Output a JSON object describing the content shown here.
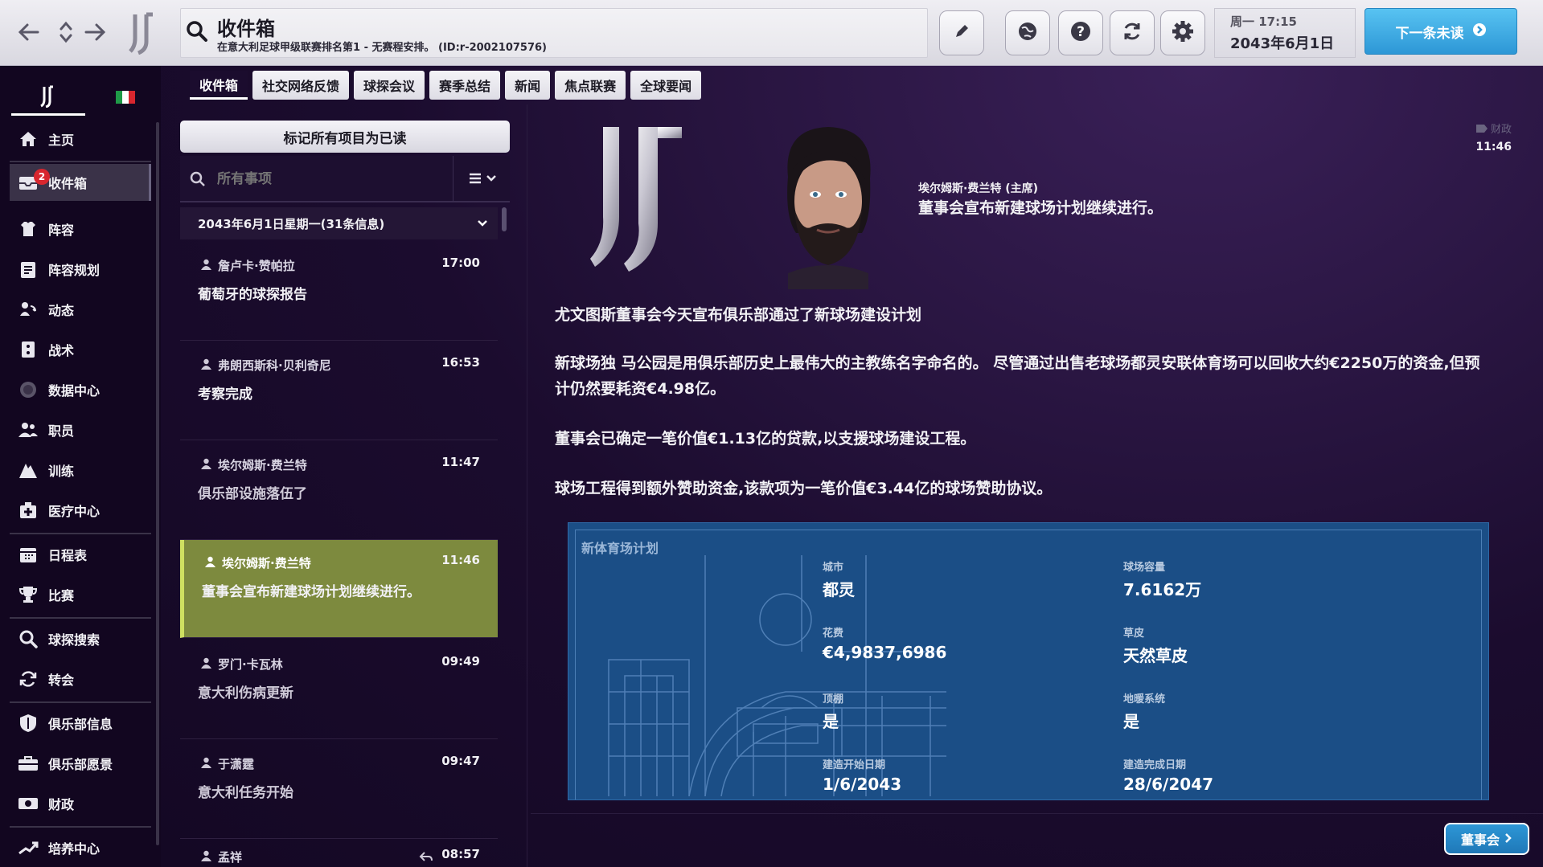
{
  "topbar": {
    "title": "收件箱",
    "subtitle": "在意大利足球甲级联赛排名第1 - 无赛程安排。 (ID:r-2002107576)",
    "day_time": "周一 17:15",
    "date": "2043年6月1日",
    "next_unread_label": "下一条未读",
    "icons": [
      "back-arrow-icon",
      "updown-icon",
      "forward-arrow-icon",
      "edit-icon",
      "globe-icon",
      "help-icon",
      "refresh-icon",
      "settings-icon"
    ]
  },
  "sidebar": {
    "inbox_badge": "2",
    "items": [
      {
        "label": "主页",
        "icon": "home-icon"
      },
      {
        "label": "收件箱",
        "icon": "inbox-icon"
      },
      {
        "label": "阵容",
        "icon": "shirt-icon"
      },
      {
        "label": "阵容规划",
        "icon": "clipboard-icon"
      },
      {
        "label": "动态",
        "icon": "dynamics-icon"
      },
      {
        "label": "战术",
        "icon": "tactics-icon"
      },
      {
        "label": "数据中心",
        "icon": "data-icon"
      },
      {
        "label": "职员",
        "icon": "staff-icon"
      },
      {
        "label": "训练",
        "icon": "training-icon"
      },
      {
        "label": "医疗中心",
        "icon": "medical-icon"
      },
      {
        "label": "日程表",
        "icon": "calendar-icon"
      },
      {
        "label": "比赛",
        "icon": "trophy-icon"
      },
      {
        "label": "球探搜索",
        "icon": "magnifier-icon"
      },
      {
        "label": "转会",
        "icon": "transfer-icon"
      },
      {
        "label": "俱乐部信息",
        "icon": "shield-icon"
      },
      {
        "label": "俱乐部愿景",
        "icon": "vision-icon"
      },
      {
        "label": "财政",
        "icon": "finance-icon"
      },
      {
        "label": "培养中心",
        "icon": "development-icon"
      }
    ]
  },
  "tabs": [
    "收件箱",
    "社交网络反馈",
    "球探会议",
    "赛季总结",
    "新闻",
    "焦点联赛",
    "全球要闻"
  ],
  "inbox": {
    "mark_all_read": "标记所有项目为已读",
    "filter_placeholder": "所有事项",
    "group_header": "2043年6月1日星期一(31条信息)",
    "messages": [
      {
        "sender": "詹卢卡·赞帕拉",
        "time": "17:00",
        "subject": "葡萄牙的球探报告"
      },
      {
        "sender": "弗朗西斯科·贝利奇尼",
        "time": "16:53",
        "subject": "考察完成"
      },
      {
        "sender": "埃尔姆斯·费兰特",
        "time": "11:47",
        "subject": "俱乐部设施落伍了"
      },
      {
        "sender": "埃尔姆斯·费兰特",
        "time": "11:46",
        "subject": "董事会宣布新建球场计划继续进行。"
      },
      {
        "sender": "罗门·卡瓦林",
        "time": "09:49",
        "subject": "意大利伤病更新"
      },
      {
        "sender": "于潇霆",
        "time": "09:47",
        "subject": "意大利任务开始"
      },
      {
        "sender": "孟祥",
        "time": "08:57",
        "subject": ""
      }
    ]
  },
  "content": {
    "sender_role": "埃尔姆斯·费兰特 (主席)",
    "headline": "董事会宣布新建球场计划继续进行。",
    "tag": "财政",
    "time": "11:46",
    "paragraphs": [
      "尤文图斯董事会今天宣布俱乐部通过了新球场建设计划",
      "新球场独 马公园是用俱乐部历史上最伟大的主教练名字命名的。 尽管通过出售老球场都灵安联体育场可以回收大约€2250万的资金,但预计仍然要耗资€4.98亿。",
      "董事会已确定一笔价值€1.13亿的贷款,以支援球场建设工程。",
      "球场工程得到额外赞助资金,该款项为一笔价值€3.44亿的球场赞助协议。"
    ],
    "stadium": {
      "title": "新体育场计划",
      "city_label": "城市",
      "city": "都灵",
      "capacity_label": "球场容量",
      "capacity": "7.6162万",
      "cost_label": "花费",
      "cost": "€4,9837,6986",
      "pitch_label": "草皮",
      "pitch": "天然草皮",
      "roof_label": "顶棚",
      "roof": "是",
      "heating_label": "地暖系统",
      "heating": "是",
      "start_label": "建造开始日期",
      "start": "1/6/2043",
      "end_label": "建造完成日期",
      "end": "28/6/2047"
    },
    "board_button": "董事会"
  },
  "colors": {
    "accent_blue": "#2d97d6",
    "selected_row": "#7d8a3e",
    "badge_red": "#d8262e"
  }
}
